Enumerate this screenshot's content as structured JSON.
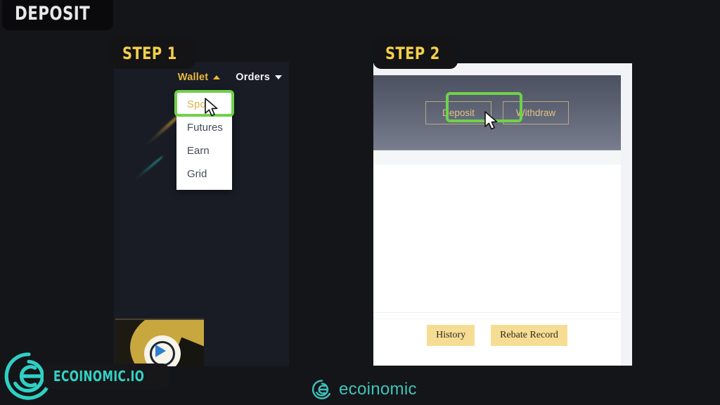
{
  "page": {
    "title": "DEPOSIT",
    "background_color": "#141518",
    "accent_green": "#6fd24a",
    "accent_gold": "#f3cf4b",
    "accent_teal": "#32d4c6"
  },
  "step1": {
    "badge_label": "STEP 1",
    "navbar": {
      "items": [
        {
          "label": "Wallet",
          "caret": "caret-up-icon",
          "state": "active",
          "color": "#e9b93c"
        },
        {
          "label": "Orders",
          "caret": "caret-down-icon",
          "state": "default",
          "color": "#f2f2f4"
        }
      ]
    },
    "dropdown": {
      "items": [
        {
          "label": "Spot",
          "selected": true,
          "highlighted": true
        },
        {
          "label": "Futures",
          "selected": false,
          "highlighted": false
        },
        {
          "label": "Earn",
          "selected": false,
          "highlighted": false
        },
        {
          "label": "Grid",
          "selected": false,
          "highlighted": false
        }
      ]
    },
    "video_overlay": {
      "play_icon": "play-arrow-icon"
    }
  },
  "step2": {
    "badge_label": "STEP 2",
    "banner_buttons": [
      {
        "label": "Deposit",
        "highlighted": true
      },
      {
        "label": "Withdraw",
        "highlighted": false
      }
    ],
    "record_buttons": [
      {
        "label": "History"
      },
      {
        "label": "Rebate Record"
      }
    ]
  },
  "branding": {
    "left_logo_text": "ECOINOMIC.IO",
    "center_watermark_text": "ecoinomic"
  }
}
